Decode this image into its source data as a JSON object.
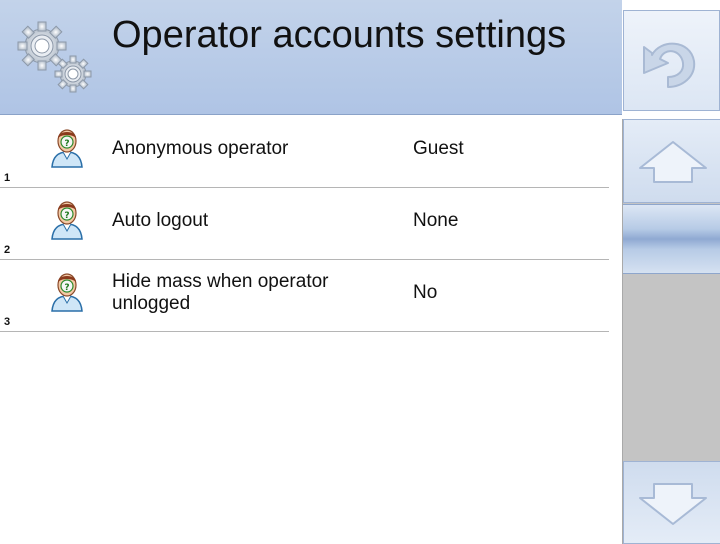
{
  "header": {
    "title": "Operator accounts settings",
    "icon": "gears-icon"
  },
  "back_button": {
    "icon": "undo-arrow-icon"
  },
  "items": [
    {
      "number": "1",
      "label": "Anonymous operator",
      "value": "Guest",
      "icon": "operator-question-icon"
    },
    {
      "number": "2",
      "label": "Auto logout",
      "value": "None",
      "icon": "operator-question-icon"
    },
    {
      "number": "3",
      "label": "Hide mass when operator unlogged",
      "value": "No",
      "icon": "operator-question-icon"
    }
  ],
  "scrollbar": {
    "up_icon": "arrow-up-icon",
    "down_icon": "arrow-down-icon"
  },
  "colors": {
    "header_bg": "#b3c7e6",
    "button_border": "#9fb3d3",
    "scroll_track": "#c4c4c4",
    "divider": "#b5b5b5"
  }
}
